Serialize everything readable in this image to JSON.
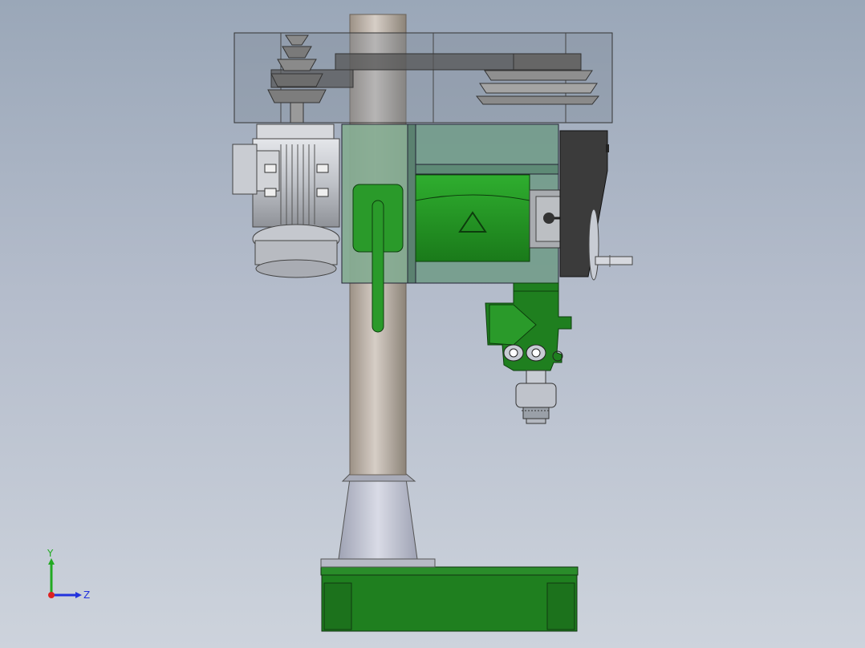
{
  "view": {
    "background_top": "#9aa7b8",
    "background_bottom": "#cdd3dc"
  },
  "colors": {
    "machine_green": "#1f8a1f",
    "guard_green": "#6f9a86",
    "column_gray": "#b9aea2",
    "metal_gray": "#c8ccd4",
    "dark_gray": "#3f3f3f"
  },
  "triad": {
    "y_label": "Y",
    "z_label": "Z",
    "y_color": "#22aa22",
    "z_color": "#2233dd",
    "x_color": "#dd2222"
  }
}
